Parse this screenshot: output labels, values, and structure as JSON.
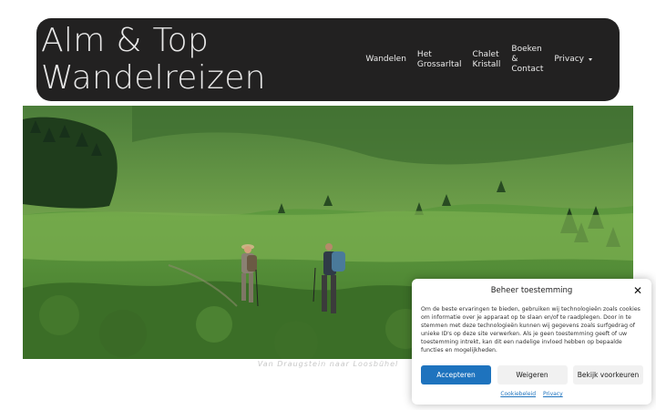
{
  "header": {
    "title_line1": "Alm & Top",
    "title_line2": "Wandelreizen",
    "nav": {
      "wandelen": "Wandelen",
      "grossarltal_1": "Het",
      "grossarltal_2": "Grossarltal",
      "chalet_1": "Chalet",
      "chalet_2": "Kristall",
      "boeken_1": "Boeken",
      "boeken_2": "&",
      "boeken_3": "Contact",
      "privacy": "Privacy"
    }
  },
  "hero": {
    "caption": "Van Draugstein naar Loosbühel"
  },
  "cookie": {
    "title": "Beheer toestemming",
    "text": "Om de beste ervaringen te bieden, gebruiken wij technologieën zoals cookies om informatie over je apparaat op te slaan en/of te raadplegen. Door in te stemmen met deze technologieën kunnen wij gegevens zoals surfgedrag of unieke ID's op deze site verwerken. Als je geen toestemming geeft of uw toestemming intrekt, kan dit een nadelige invloed hebben op bepaalde functies en mogelijkheden.",
    "accept": "Accepteren",
    "deny": "Weigeren",
    "preferences": "Bekijk voorkeuren",
    "link_cookie": "Cookiebeleid",
    "link_privacy": "Privacy",
    "close_symbol": "✕",
    "accent_color": "#1e73be"
  }
}
